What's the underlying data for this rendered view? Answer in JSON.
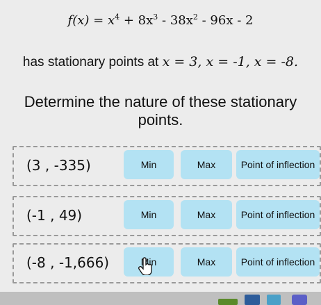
{
  "equation": {
    "lhs": "f(x)",
    "eq": "=",
    "t1": "x",
    "t1_exp": "4",
    "t2": "+ 8x",
    "t2_exp": "3",
    "t3": "- 38x",
    "t3_exp": "2",
    "t4": "- 96x - 2"
  },
  "line2": {
    "before": "has stationary points at ",
    "p1": "x = 3, ",
    "p2": "x = -1, ",
    "p3": "x = -8."
  },
  "prompt": "Determine the nature of these stationary points.",
  "rows": [
    {
      "point": "(3 , -335)"
    },
    {
      "point": "(-1 , 49)"
    },
    {
      "point": "(-8 , -1,666)"
    }
  ],
  "options": {
    "min": "Min",
    "max": "Max",
    "inflection": "Point of inflection"
  },
  "icons": {
    "cursor": "hand-pointer-icon"
  }
}
